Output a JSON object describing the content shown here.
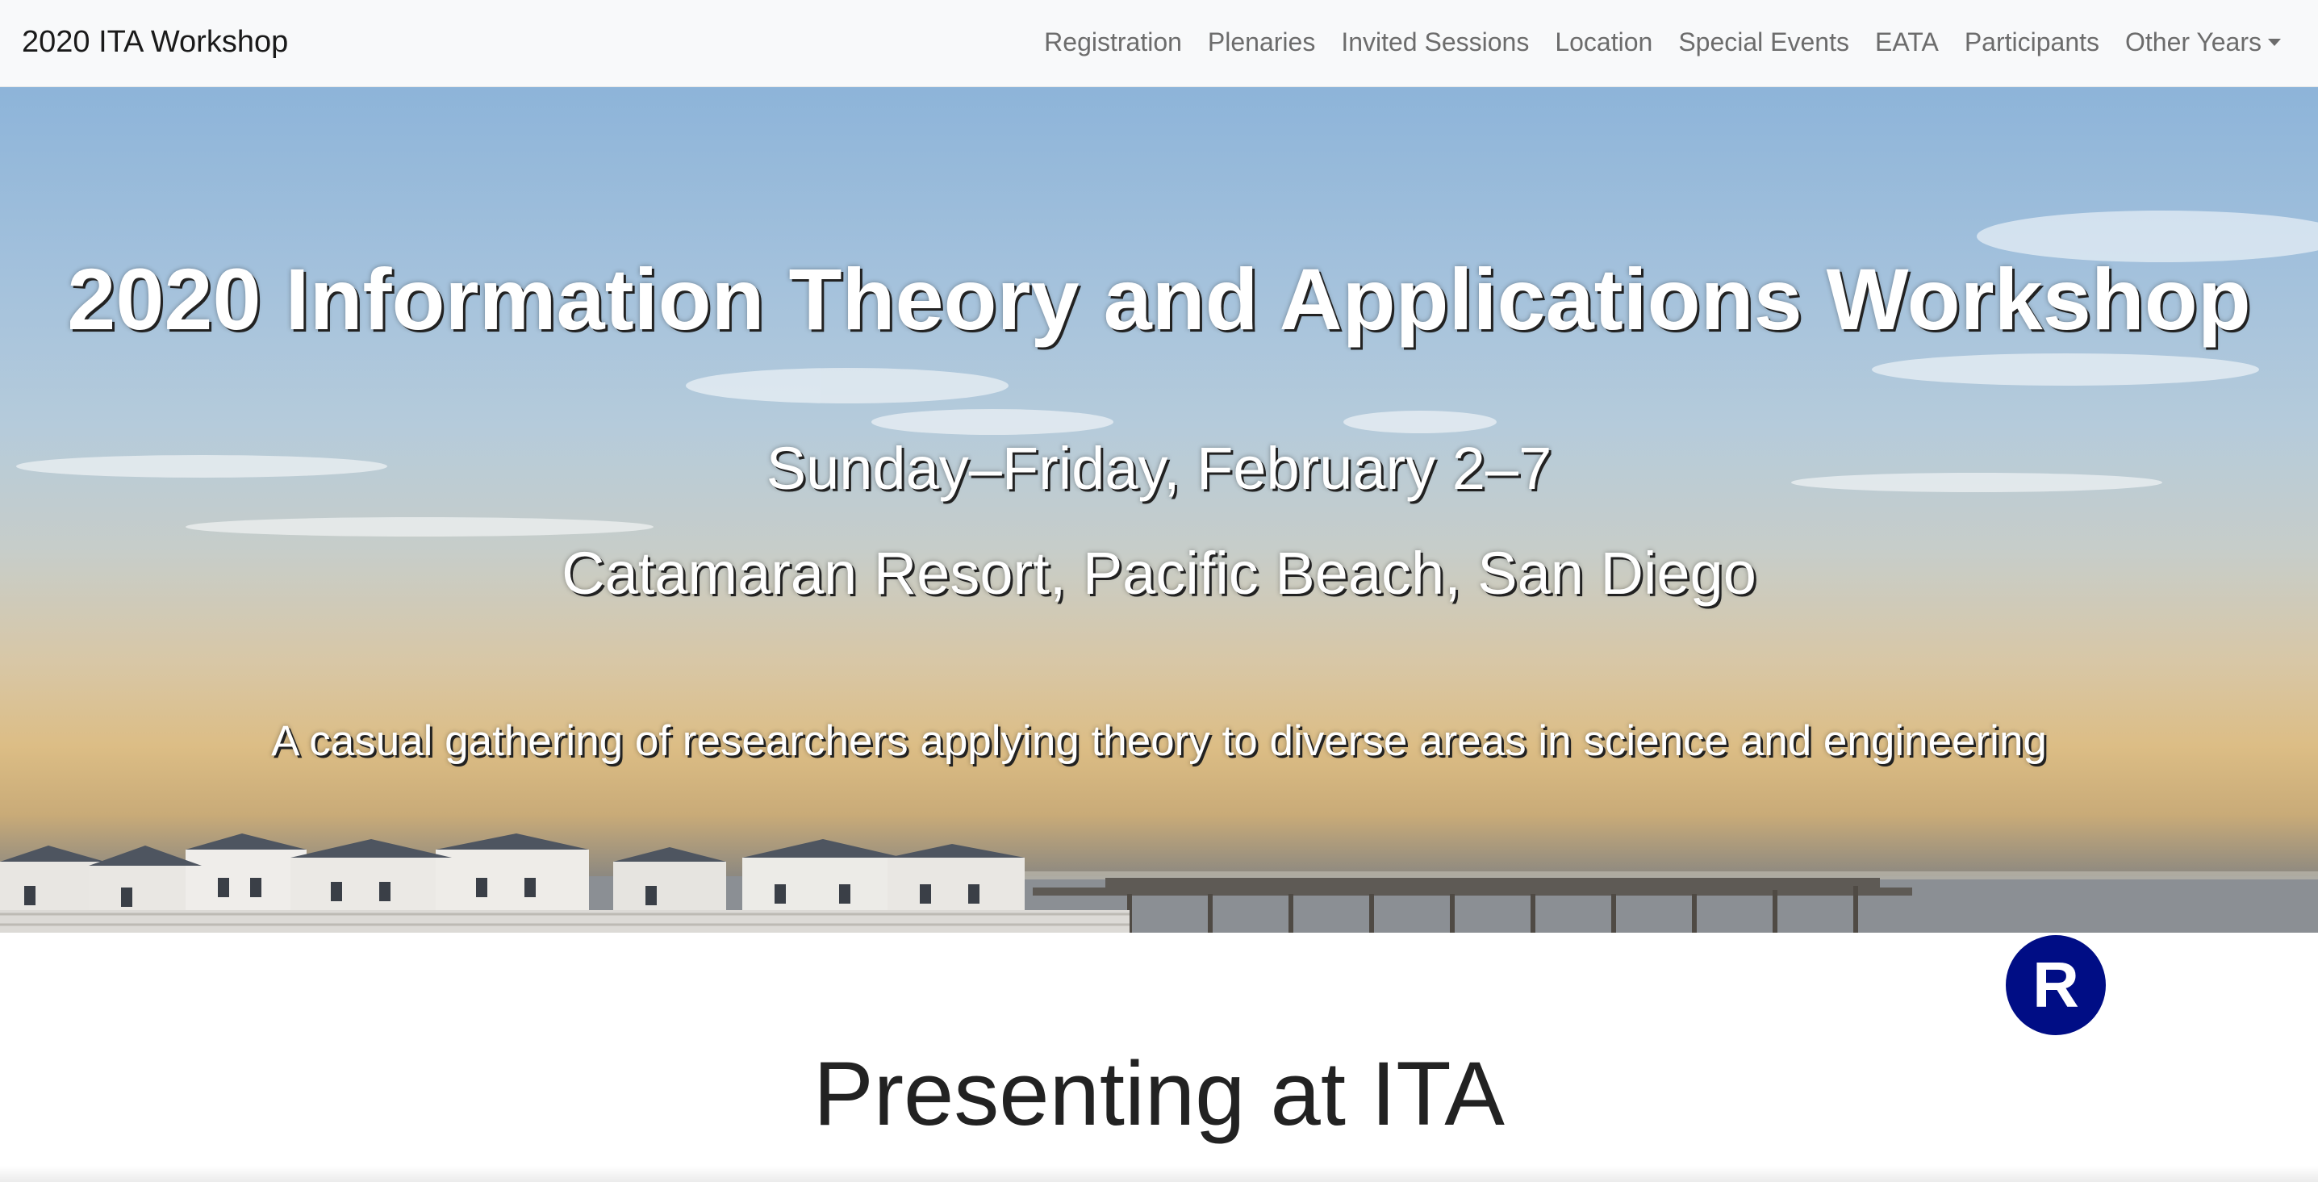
{
  "navbar": {
    "brand": "2020 ITA Workshop",
    "links": [
      {
        "label": "Registration"
      },
      {
        "label": "Plenaries"
      },
      {
        "label": "Invited Sessions"
      },
      {
        "label": "Location"
      },
      {
        "label": "Special Events"
      },
      {
        "label": "EATA"
      },
      {
        "label": "Participants"
      },
      {
        "label": "Other Years"
      }
    ]
  },
  "hero": {
    "title": "2020 Information Theory and Applications Workshop",
    "dates": "Sunday–Friday, February 2–7",
    "location": "Catamaran Resort, Pacific Beach, San Diego",
    "tagline": "A casual gathering of researchers applying theory to diverse areas in science and engineering"
  },
  "badge": {
    "letter": "R",
    "color": "#000d85"
  },
  "main": {
    "heading": "Presenting at ITA"
  }
}
